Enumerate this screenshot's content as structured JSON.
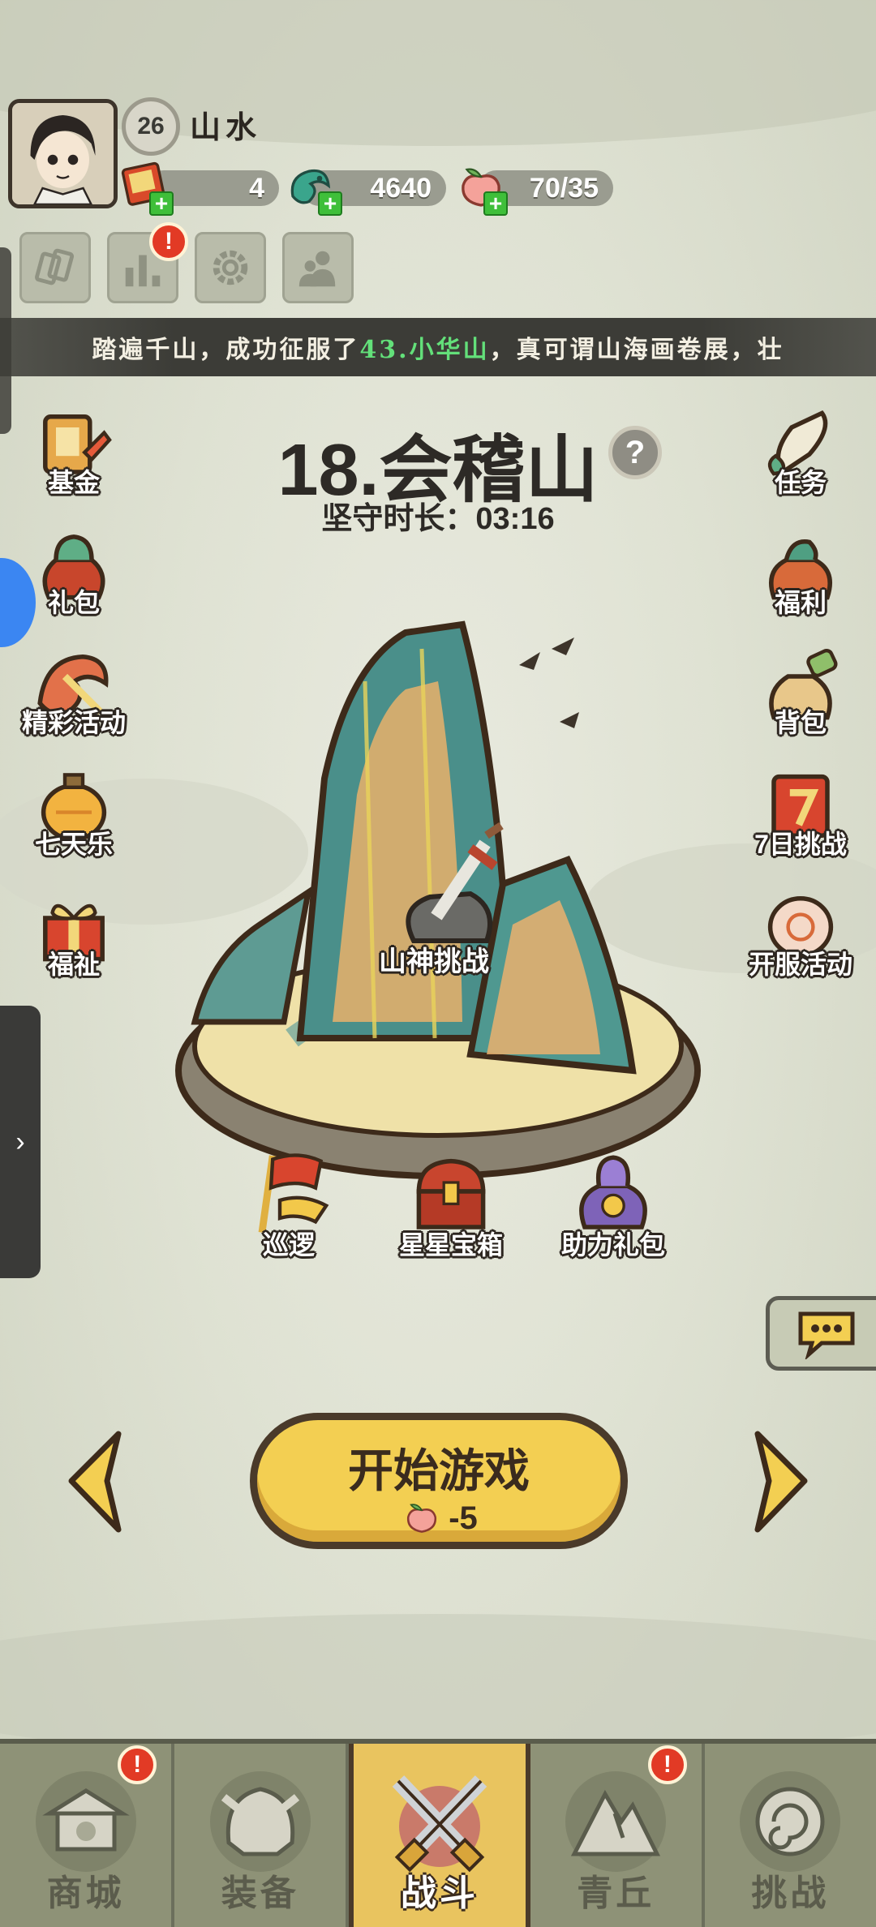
{
  "player": {
    "level": "26",
    "name": "山水"
  },
  "resources": [
    {
      "icon": "scroll-ticket-icon",
      "value": "4"
    },
    {
      "icon": "jade-dragon-icon",
      "value": "4640"
    },
    {
      "icon": "peach-icon",
      "value": "70/35"
    }
  ],
  "ticker": {
    "prefix": "踏遍千山，成功征服了",
    "highlight": "43.小华山",
    "suffix": "，真可谓山海画卷展，壮"
  },
  "stage": {
    "title": "18.会稽山",
    "help": "?",
    "hold_label": "坚守时长：",
    "hold_time": "03:16"
  },
  "left_menu": [
    "基金",
    "礼包",
    "精彩活动",
    "七天乐",
    "福祉"
  ],
  "right_menu": [
    "任务",
    "福利",
    "背包",
    "7日挑战",
    "开服活动"
  ],
  "center_badge": "山神挑战",
  "bottom_items": [
    "巡逻",
    "星星宝箱",
    "助力礼包"
  ],
  "start": {
    "label": "开始游戏",
    "cost": "-5"
  },
  "alert_mark": "!",
  "nav": [
    {
      "label": "商城",
      "alert": true
    },
    {
      "label": "装备",
      "alert": false
    },
    {
      "label": "战斗",
      "alert": false,
      "active": true
    },
    {
      "label": "青丘",
      "alert": true
    },
    {
      "label": "挑战",
      "alert": false
    }
  ],
  "colors": {
    "accent": "#f3cf52",
    "nav_bg": "#8e9277",
    "alert": "#e23a25",
    "highlight": "#63e07a"
  }
}
